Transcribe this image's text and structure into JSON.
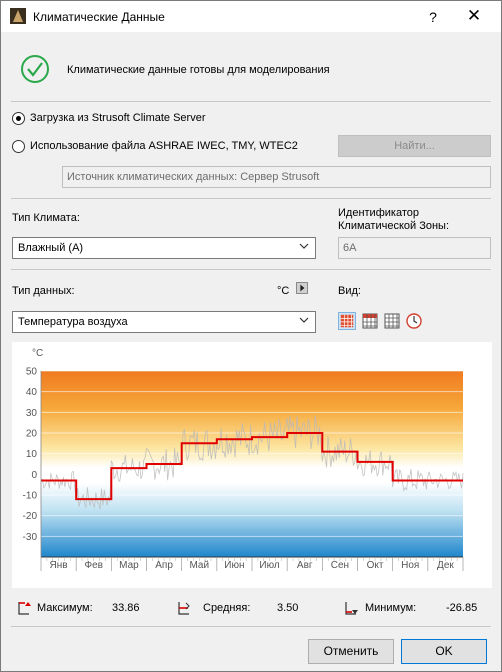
{
  "window": {
    "title": "Климатические Данные",
    "help": "?",
    "close": "✕"
  },
  "status": {
    "text": "Климатические данные готовы для моделирования"
  },
  "source": {
    "option_server": "Загрузка из Strusoft Climate Server",
    "option_file": "Использование файла ASHRAE IWEC, TMY, WTEC2",
    "find_button": "Найти...",
    "source_field": "Источник климатических данных: Сервер Strusoft"
  },
  "climate": {
    "type_label": "Тип Климата:",
    "type_value": "Влажный (A)",
    "zone_label_1": "Идентификатор",
    "zone_label_2": "Климатической Зоны:",
    "zone_value": "6A"
  },
  "datatype": {
    "label": "Тип данных:",
    "unit": "°C",
    "value": "Температура воздуха",
    "view_label": "Вид:"
  },
  "chart_data": {
    "type": "line",
    "ylabel": "°C",
    "ylim": [
      -40,
      50
    ],
    "yticks": [
      50,
      40,
      30,
      20,
      10,
      0,
      -10,
      -20,
      -30
    ],
    "categories": [
      "Янв",
      "Фев",
      "Мар",
      "Апр",
      "Май",
      "Июн",
      "Июл",
      "Авг",
      "Сен",
      "Окт",
      "Ноя",
      "Дек"
    ],
    "series": [
      {
        "values": [
          -3,
          -12,
          3,
          5,
          15,
          17,
          18,
          20,
          11,
          6,
          -3,
          -3
        ]
      }
    ],
    "colors": {
      "avg_line": "#e00000",
      "noise": "#b8b8b8",
      "hot": "#f28a2a",
      "cold": "#1a8ad0"
    }
  },
  "stats": {
    "max_label": "Максимум:",
    "max_value": "33.86",
    "avg_label": "Средняя:",
    "avg_value": "3.50",
    "min_label": "Минимум:",
    "min_value": "-26.85"
  },
  "footer": {
    "cancel": "Отменить",
    "ok": "OK"
  }
}
